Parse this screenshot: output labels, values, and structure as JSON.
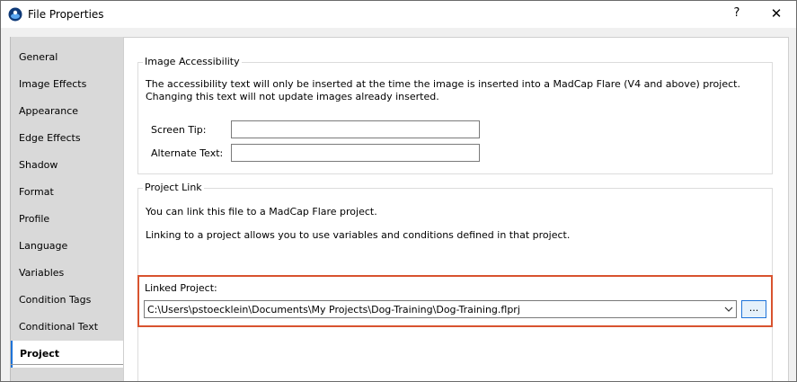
{
  "window": {
    "title": "File Properties",
    "help_label": "?",
    "close_label": "✕"
  },
  "nav": {
    "items": [
      {
        "label": "General"
      },
      {
        "label": "Image Effects"
      },
      {
        "label": "Appearance"
      },
      {
        "label": "Edge Effects"
      },
      {
        "label": "Shadow"
      },
      {
        "label": "Format"
      },
      {
        "label": "Profile"
      },
      {
        "label": "Language"
      },
      {
        "label": "Variables"
      },
      {
        "label": "Condition Tags"
      },
      {
        "label": "Conditional Text"
      },
      {
        "label": "Project",
        "selected": true
      }
    ]
  },
  "accessibility": {
    "title": "Image Accessibility",
    "description": "The accessibility text will only be inserted at the time the image is inserted into a MadCap Flare (V4 and above) project. Changing this text will not update images already inserted.",
    "screen_tip_label": "Screen Tip:",
    "screen_tip_value": "",
    "alternate_text_label": "Alternate Text:",
    "alternate_text_value": ""
  },
  "project_link": {
    "title": "Project Link",
    "line1": "You can link this file to a MadCap Flare project.",
    "line2": "Linking to a project allows you to use variables and conditions defined in that project.",
    "linked_project_label": "Linked Project:",
    "linked_project_value": "C:\\Users\\pstoecklein\\Documents\\My Projects\\Dog-Training\\Dog-Training.flprj",
    "browse_label": "..."
  },
  "colors": {
    "highlight": "#d8532f",
    "accent": "#1e73d9"
  }
}
